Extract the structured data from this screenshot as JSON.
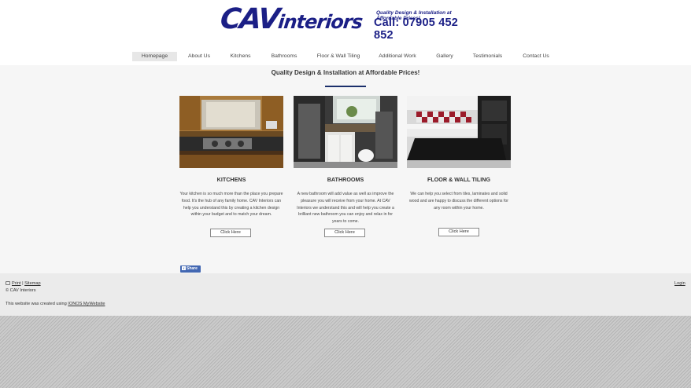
{
  "header": {
    "logo_main": "CAV",
    "logo_sub": "interiors",
    "logo_tagline": "Quality Design & Installation at Affordable Prices!",
    "logo_phone": "Call: 07905 452 852"
  },
  "nav": {
    "items": [
      "Homepage",
      "About Us",
      "Kitchens",
      "Bathrooms",
      "Floor & Wall Tiling",
      "Additional Work",
      "Gallery",
      "Testimonials",
      "Contact Us"
    ],
    "active": "Homepage"
  },
  "main": {
    "title": "Quality Design & Installation at Affordable Prices!",
    "cards": [
      {
        "title": "KITCHENS",
        "text": "Your kitchen is so much more than the place you prepare food. It's the hub of any family home. CAV Interiors can help you understand this by creating a kitchen design within your budget and to match your dream.",
        "button": "Click Here"
      },
      {
        "title": "BATHROOMS",
        "text": "A new bathroom will add value as well as improve the pleasure you will receive from your home. At CAV Interiors we understand this and will help you create a brilliant new bathroom you can enjoy and relax in for years to come.",
        "button": "Click Here"
      },
      {
        "title": "FLOOR & WALL TILING",
        "text": "We can help you select from tiles, laminates and solid wood and are happy to discuss the different options for any room within your home.",
        "button": "Click Here"
      }
    ],
    "share_label": "Share"
  },
  "footer": {
    "print_label": "Print",
    "sitemap_label": "Sitemap",
    "copyright": "© CAV Interiors",
    "created_prefix": "This website was created using ",
    "created_link": "IONOS MyWebsite",
    "login_label": "Login"
  },
  "colors": {
    "brand": "#1b1f86",
    "accent_rule": "#1b2f6b",
    "facebook": "#4267b2"
  }
}
